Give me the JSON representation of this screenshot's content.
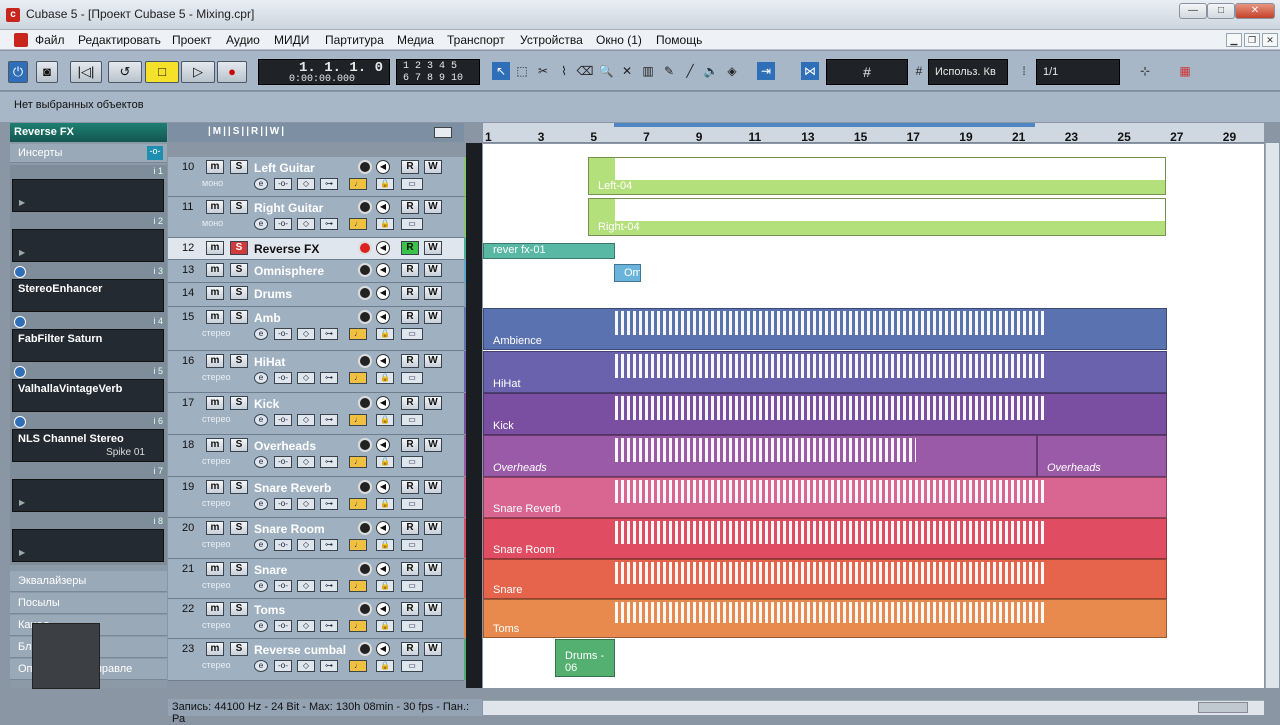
{
  "window": {
    "title": "Cubase 5 - [Проект Cubase 5 - Mixing.cpr]",
    "buttons": [
      "—",
      "□",
      "✕"
    ]
  },
  "menu": [
    "Файл",
    "Редактировать",
    "Проект",
    "Аудио",
    "МИДИ",
    "Партитура",
    "Медиа",
    "Транспорт",
    "Устройства",
    "Окно (1)",
    "Помощь"
  ],
  "toolbar": {
    "position_bars": "1. 1. 1.   0",
    "position_time": "0:00:00.000",
    "marker_top": "1  2  3  4  5",
    "marker_bottom": "6  7  8  9  10",
    "snap_label": "Использ. Кв",
    "quantize": "1/1"
  },
  "info_line": "Нет выбранных объектов",
  "inspector": {
    "track_name": "Reverse FX",
    "inserts_label": "Инсерты",
    "slots": [
      {
        "num": "i 1",
        "name": "",
        "preset": ""
      },
      {
        "num": "i 2",
        "name": "",
        "preset": ""
      },
      {
        "num": "i 3",
        "name": "StereoEnhancer",
        "preset": ""
      },
      {
        "num": "i 4",
        "name": "FabFilter Saturn",
        "preset": ""
      },
      {
        "num": "i 5",
        "name": "ValhallaVintageVerb",
        "preset": ""
      },
      {
        "num": "i 6",
        "name": "NLS Channel Stereo",
        "preset": "Spike 01"
      },
      {
        "num": "i 7",
        "name": "",
        "preset": ""
      },
      {
        "num": "i 8",
        "name": "",
        "preset": ""
      }
    ],
    "sections": [
      "Эквалайзеры",
      "Посылы",
      "Канал",
      "Блокнот",
      "Определения управле"
    ]
  },
  "tracks": [
    {
      "no": "10",
      "name": "Left Guitar",
      "mode": "моно",
      "color": "#88c46a"
    },
    {
      "no": "11",
      "name": "Right Guitar",
      "mode": "моно",
      "color": "#88c46a"
    },
    {
      "no": "12",
      "name": "Reverse FX",
      "mode": "",
      "color": "#48b08c"
    },
    {
      "no": "13",
      "name": "Omnisphere",
      "mode": "",
      "color": "#5aa8d0"
    },
    {
      "no": "14",
      "name": "Drums",
      "mode": "",
      "color": "#7aa0c0"
    },
    {
      "no": "15",
      "name": "Amb",
      "mode": "стерео",
      "color": "#5d74b0"
    },
    {
      "no": "16",
      "name": "HiHat",
      "mode": "стерео",
      "color": "#6a62ac"
    },
    {
      "no": "17",
      "name": "Kick",
      "mode": "стерео",
      "color": "#7a4ea0"
    },
    {
      "no": "18",
      "name": "Overheads",
      "mode": "стерео",
      "color": "#9a5aa8"
    },
    {
      "no": "19",
      "name": "Snare Reverb",
      "mode": "стерео",
      "color": "#c85a8a"
    },
    {
      "no": "20",
      "name": "Snare Room",
      "mode": "стерео",
      "color": "#d84a62"
    },
    {
      "no": "21",
      "name": "Snare",
      "mode": "стерео",
      "color": "#e0604a"
    },
    {
      "no": "22",
      "name": "Toms",
      "mode": "стерео",
      "color": "#e0884a"
    },
    {
      "no": "23",
      "name": "Reverse cumbal",
      "mode": "стерео",
      "color": "#4eb070"
    }
  ],
  "ruler": [
    "1",
    "3",
    "5",
    "7",
    "9",
    "11",
    "13",
    "15",
    "17",
    "19",
    "21",
    "23",
    "25",
    "27",
    "29"
  ],
  "events": [
    "Left-04",
    "Right-04",
    "rever fx-01",
    "Om",
    "Ambience",
    "HiHat",
    "Kick",
    "Overheads",
    "Overheads",
    "Snare Reverb",
    "Snare Room",
    "Snare",
    "Toms",
    "Drums - 06"
  ],
  "status": "Запись: 44100 Hz - 24 Bit - Max: 130h 08min - 30 fps - Пан.: Ра"
}
